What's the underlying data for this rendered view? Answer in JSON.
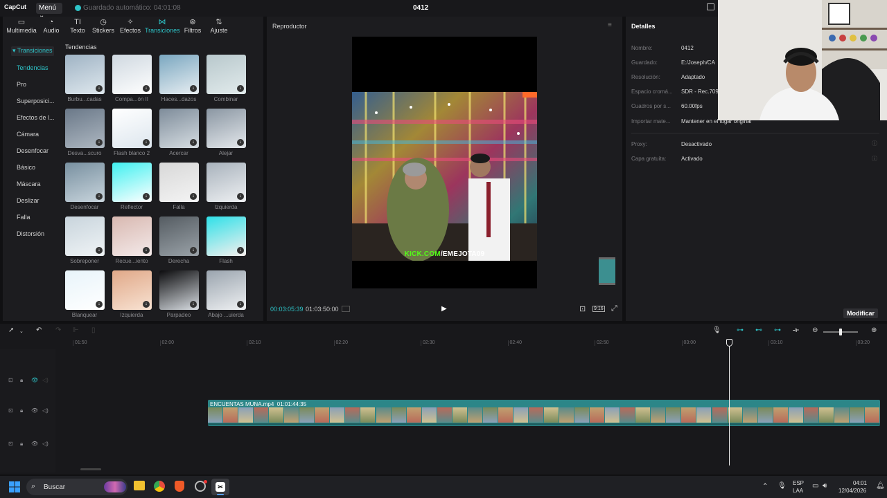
{
  "app": {
    "logo": "CapCut",
    "menu_label": "Menú",
    "autosave": "Guardado automático: 04:01:08",
    "project_title": "0412"
  },
  "toolbar": {
    "tabs": [
      {
        "label": "Multimedia",
        "icon": "media-icon"
      },
      {
        "label": "Audio",
        "icon": "audio-icon"
      },
      {
        "label": "Texto",
        "icon": "text-icon"
      },
      {
        "label": "Stickers",
        "icon": "sticker-icon"
      },
      {
        "label": "Efectos",
        "icon": "effects-icon"
      },
      {
        "label": "Transiciones",
        "icon": "transitions-icon",
        "active": true
      },
      {
        "label": "Filtros",
        "icon": "filters-icon"
      },
      {
        "label": "Ajuste",
        "icon": "adjust-icon"
      }
    ]
  },
  "sidebar": {
    "header": "Transiciones",
    "items": [
      "Tendencias",
      "Pro",
      "Superposici...",
      "Efectos de l...",
      "Cámara",
      "Desenfocar",
      "Básico",
      "Máscara",
      "Deslizar",
      "Falla",
      "Distorsión"
    ]
  },
  "gallery": {
    "title": "Tendencias",
    "items": [
      {
        "label": "Burbu...cadas"
      },
      {
        "label": "Compa...ón II"
      },
      {
        "label": "Haces...dazos"
      },
      {
        "label": "Combinar"
      },
      {
        "label": "Desva...scuro"
      },
      {
        "label": "Flash blanco 2"
      },
      {
        "label": "Acercar"
      },
      {
        "label": "Alejar"
      },
      {
        "label": "Desenfocar"
      },
      {
        "label": "Reflector"
      },
      {
        "label": "Falla"
      },
      {
        "label": "Izquierda"
      },
      {
        "label": "Sobreponer"
      },
      {
        "label": "Recue...iento"
      },
      {
        "label": "Derecha"
      },
      {
        "label": "Flash"
      },
      {
        "label": "Blanquear"
      },
      {
        "label": "Izquierda"
      },
      {
        "label": "Parpadeo"
      },
      {
        "label": "Abajo ...uierda"
      }
    ]
  },
  "player": {
    "title": "Reproductor",
    "overlay_text_green": "KICK.COM",
    "overlay_text_white": "/EMEJOTA09",
    "time_current": "00:03:05:39",
    "time_total": "01:03:50:00",
    "ratio_label": "9:16"
  },
  "details": {
    "title": "Detalles",
    "rows": [
      {
        "key": "Nombre:",
        "value": "0412"
      },
      {
        "key": "Guardado:",
        "value": "E:/Joseph/CA"
      },
      {
        "key": "Resolución:",
        "value": "Adaptado"
      },
      {
        "key": "Espacio cromá...",
        "value": "SDR - Rec.709"
      },
      {
        "key": "Cuadros por s...",
        "value": "60.00fps"
      },
      {
        "key": "Importar mate...",
        "value": "Mantener en el lugar original"
      }
    ],
    "rows2": [
      {
        "key": "Proxy:",
        "value": "Desactivado"
      },
      {
        "key": "Capa gratuita:",
        "value": "Activado"
      }
    ],
    "modify_label": "Modificar"
  },
  "timeline": {
    "ruler": [
      "01:50",
      "02:00",
      "02:10",
      "02:20",
      "02:30",
      "02:40",
      "02:50",
      "03:00",
      "03:10",
      "03:20"
    ],
    "clip_name": "ENCUENTAS MUNA.mp4",
    "clip_duration": "01:01:44:35"
  },
  "taskbar": {
    "search_placeholder": "Buscar",
    "lang_top": "ESP",
    "lang_bottom": "LAA",
    "time": "04:01",
    "date": "12/04/2026"
  },
  "colors": {
    "accent": "#2ec4c8",
    "clip": "#2c8688",
    "background": "#101012"
  }
}
